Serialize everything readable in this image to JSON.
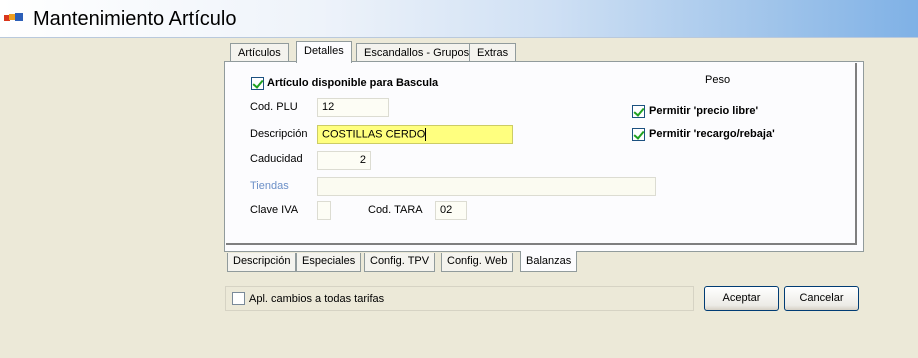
{
  "window": {
    "title": "Mantenimiento Artículo",
    "icon": "app-blocks-icon"
  },
  "top_tabs": [
    {
      "label": "Artículos"
    },
    {
      "label": "Detalles",
      "active": true
    },
    {
      "label": "Escandallos - Grupos"
    },
    {
      "label": "Extras"
    }
  ],
  "form": {
    "disponible_bascula": {
      "label": "Artículo disponible para Bascula",
      "checked": true
    },
    "cod_plu": {
      "label": "Cod. PLU",
      "value": "12"
    },
    "descripcion": {
      "label": "Descripción",
      "value": "COSTILLAS CERDO"
    },
    "caducidad": {
      "label": "Caducidad",
      "value": "2"
    },
    "tiendas": {
      "label": "Tiendas",
      "value": ""
    },
    "clave_iva": {
      "label": "Clave IVA",
      "value": ""
    },
    "cod_tara": {
      "label": "Cod. TARA",
      "value": "02"
    },
    "peso": {
      "title": "Peso",
      "precio_libre": {
        "label": "Permitir 'precio libre'",
        "checked": true
      },
      "recargo_rebaja": {
        "label": "Permitir 'recargo/rebaja'",
        "checked": true
      }
    }
  },
  "bottom_tabs": [
    {
      "label": "Descripción"
    },
    {
      "label": "Especiales"
    },
    {
      "label": "Config. TPV"
    },
    {
      "label": "Config. Web"
    },
    {
      "label": "Balanzas",
      "active": true
    }
  ],
  "footer": {
    "apply_all": {
      "label": "Apl. cambios a todas tarifas",
      "checked": false
    },
    "accept_label": "Aceptar",
    "cancel_label": "Cancelar"
  }
}
